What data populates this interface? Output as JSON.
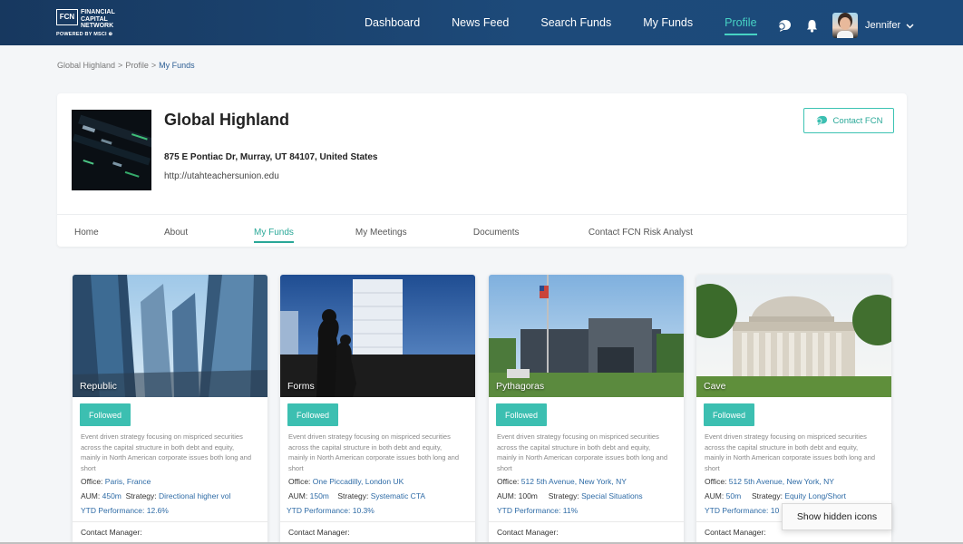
{
  "brand": {
    "logo_mark": "FCN",
    "name_lines": [
      "FINANCIAL",
      "CAPITAL",
      "NETWORK"
    ],
    "powered_by": "POWERED BY MSCI ⊕"
  },
  "nav": {
    "items": [
      {
        "label": "Dashboard",
        "active": false
      },
      {
        "label": "News Feed",
        "active": false
      },
      {
        "label": "Search Funds",
        "active": false
      },
      {
        "label": "My Funds",
        "active": false
      },
      {
        "label": "Profile",
        "active": true
      }
    ],
    "icons": [
      "chat-icon",
      "bell-icon"
    ],
    "user": {
      "name": "Jennifer"
    }
  },
  "breadcrumb": {
    "items": [
      "Global Highland",
      "Profile",
      "My Funds"
    ]
  },
  "profile": {
    "name": "Global Highland",
    "address": "875 E Pontiac Dr, Murray, UT 84107, United States",
    "url": "http://utahteachersunion.edu",
    "contact_button": "Contact FCN",
    "tabs": [
      {
        "label": "Home",
        "active": false
      },
      {
        "label": "About",
        "active": false
      },
      {
        "label": "My Funds",
        "active": true
      },
      {
        "label": "My Meetings",
        "active": false
      },
      {
        "label": "Documents",
        "active": false
      },
      {
        "label": "Contact FCN Risk Analyst",
        "active": false
      }
    ]
  },
  "labels": {
    "office": "Office:",
    "aum": "AUM:",
    "strategy": "Strategy:",
    "ytd": "YTD Performance:",
    "contact_manager": "Contact Manager:"
  },
  "funds": [
    {
      "title": "Republic",
      "follow": "Followed",
      "description": "Event driven strategy focusing on mispriced securities across the capital structure in both debt and equity, mainly in North American corporate issues both long and short",
      "office": "Paris, France",
      "aum": "450m",
      "strategy": "Directional higher vol",
      "ytd": "YTD Performance: 12.6%"
    },
    {
      "title": "Forms",
      "follow": "Followed",
      "description": "Event driven strategy focusing on mispriced securities across the capital structure in both debt and equity, mainly in North American corporate issues both long and short",
      "office": "One Piccadilly, London UK",
      "aum": "150m",
      "strategy": "Systematic CTA",
      "ytd": "YTD Performance: 10.3%"
    },
    {
      "title": "Pythagoras",
      "follow": "Followed",
      "description": "Event driven strategy focusing on mispriced securities across the capital structure in both debt and equity, mainly in North American corporate issues both long and short",
      "office": "512 5th Avenue, New York, NY",
      "aum": "100m",
      "strategy": "Special Situations",
      "ytd": "YTD Performance: 11%"
    },
    {
      "title": "Cave",
      "follow": "Followed",
      "description": "Event driven strategy focusing on mispriced securities across the capital structure in both debt and equity, mainly in North American corporate issues both long and short",
      "office": "512 5th Avenue, New York, NY",
      "aum": "50m",
      "strategy": "Equity Long/Short",
      "ytd": "YTD Performance: 10"
    }
  ],
  "tooltip": "Show hidden icons",
  "colors": {
    "nav_bg": "#1d4a7a",
    "accent": "#3cbfb1",
    "link": "#2e6ba6"
  }
}
